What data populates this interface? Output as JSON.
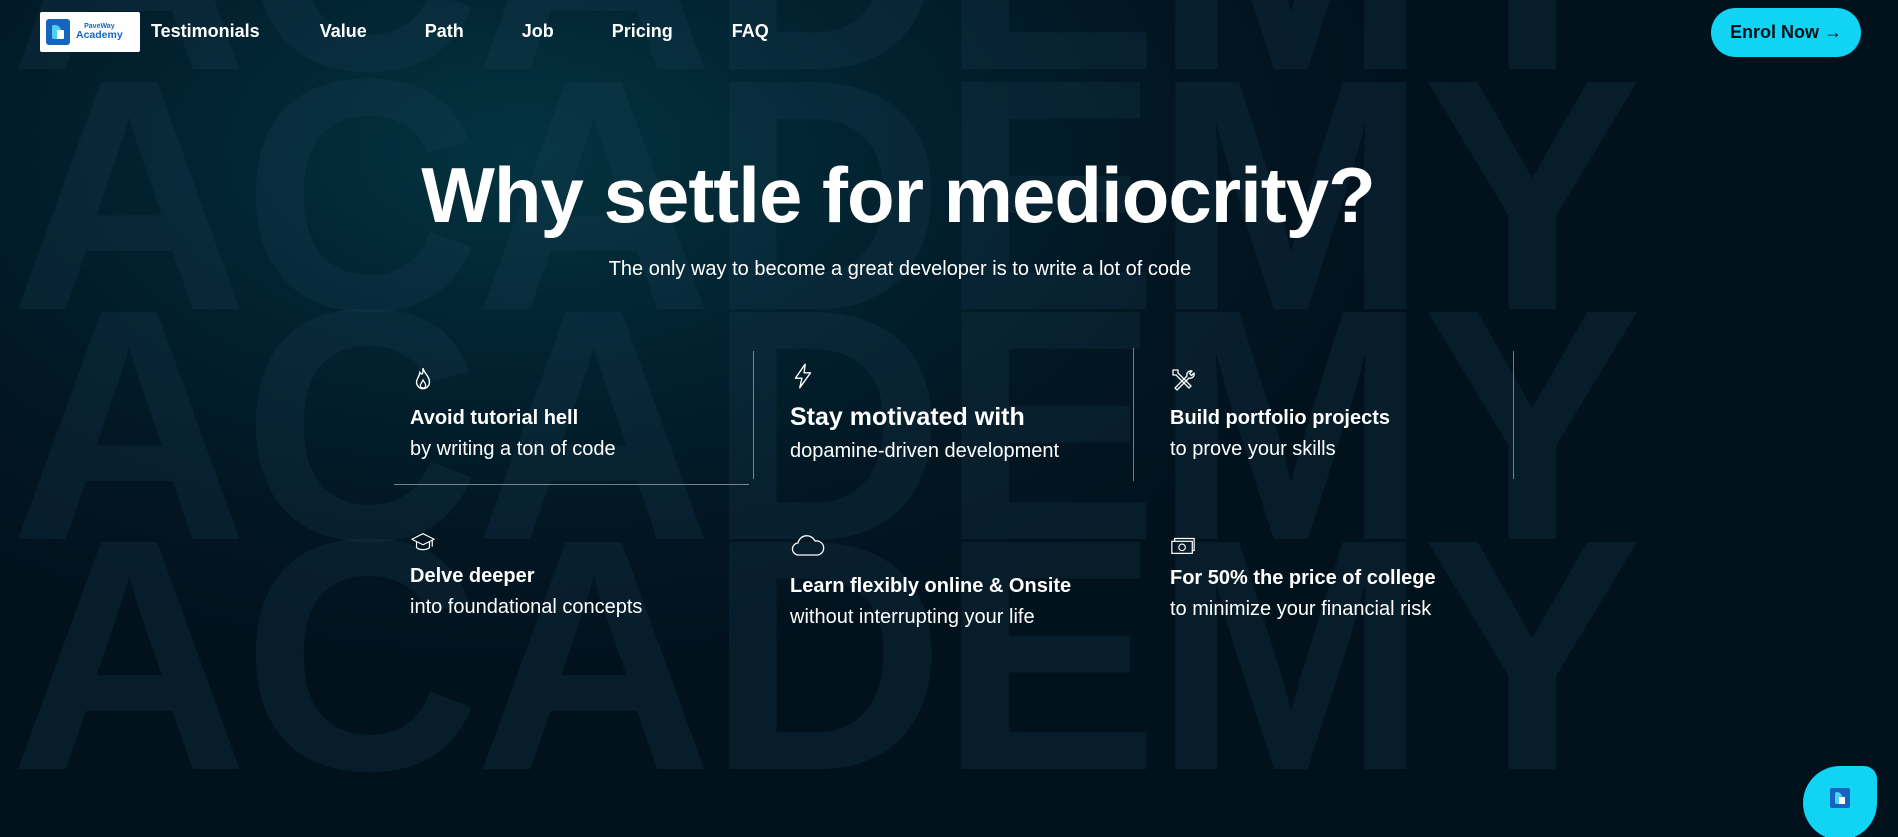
{
  "logo": {
    "small_text": "PaveWay",
    "big_text": "Academy"
  },
  "nav": {
    "links": [
      "Testimonials",
      "Value",
      "Path",
      "Job",
      "Pricing",
      "FAQ"
    ],
    "cta_label": "Enrol Now →"
  },
  "hero": {
    "title": "Why settle for mediocrity?",
    "subtitle": "The only way to become a great developer is to write a lot of code"
  },
  "features": [
    {
      "icon": "flame-icon",
      "title": "Avoid tutorial hell",
      "desc": "by writing a ton of code"
    },
    {
      "icon": "lightning-icon",
      "title": "Stay motivated with",
      "desc": "dopamine-driven development"
    },
    {
      "icon": "tools-icon",
      "title": "Build portfolio projects",
      "desc": "to prove your skills"
    },
    {
      "icon": "graduation-cap-icon",
      "title": "Delve deeper",
      "desc": "into foundational concepts"
    },
    {
      "icon": "cloud-icon",
      "title": "Learn flexibly online & Onsite",
      "desc": "without interrupting your life"
    },
    {
      "icon": "money-icon",
      "title": "For 50% the price of college",
      "desc": "to minimize your financial risk"
    }
  ],
  "background_text": "ACADEMY",
  "colors": {
    "accent": "#11d3f3",
    "background": "#021a26",
    "text": "#ffffff"
  }
}
